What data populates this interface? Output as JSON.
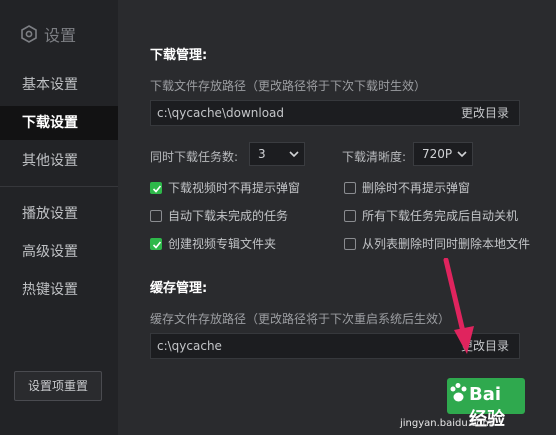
{
  "sidebar": {
    "title": "设置",
    "items": [
      {
        "label": "基本设置",
        "active": false
      },
      {
        "label": "下载设置",
        "active": true
      },
      {
        "label": "其他设置",
        "active": false
      },
      {
        "label": "播放设置",
        "active": false
      },
      {
        "label": "高级设置",
        "active": false
      },
      {
        "label": "热键设置",
        "active": false
      }
    ],
    "reset_label": "设置项重置"
  },
  "download": {
    "title": "下载管理:",
    "path_label": "下载文件存放路径（更改路径将于下次下载时生效）",
    "path_value": "c:\\qycache\\download",
    "change_dir": "更改目录",
    "concurrent_label": "同时下载任务数:",
    "concurrent_value": "3",
    "quality_label": "下载清晰度:",
    "quality_value": "720P",
    "checkboxes": [
      {
        "label": "下载视频时不再提示弹窗",
        "checked": true
      },
      {
        "label": "删除时不再提示弹窗",
        "checked": false
      },
      {
        "label": "自动下载未完成的任务",
        "checked": false
      },
      {
        "label": "所有下载任务完成后自动关机",
        "checked": false
      },
      {
        "label": "创建视频专辑文件夹",
        "checked": true
      },
      {
        "label": "从列表删除时同时删除本地文件",
        "checked": false
      }
    ]
  },
  "cache": {
    "title": "缓存管理:",
    "path_label": "缓存文件存放路径（更改路径将于下次重启系统后生效）",
    "path_value": "c:\\qycache",
    "change_dir": "更改目录"
  },
  "watermark": {
    "text": "Bai 经验",
    "url": "jingyan.baidu.com"
  },
  "colors": {
    "accent_green": "#2eb84a",
    "arrow_pink": "#e0245e"
  }
}
